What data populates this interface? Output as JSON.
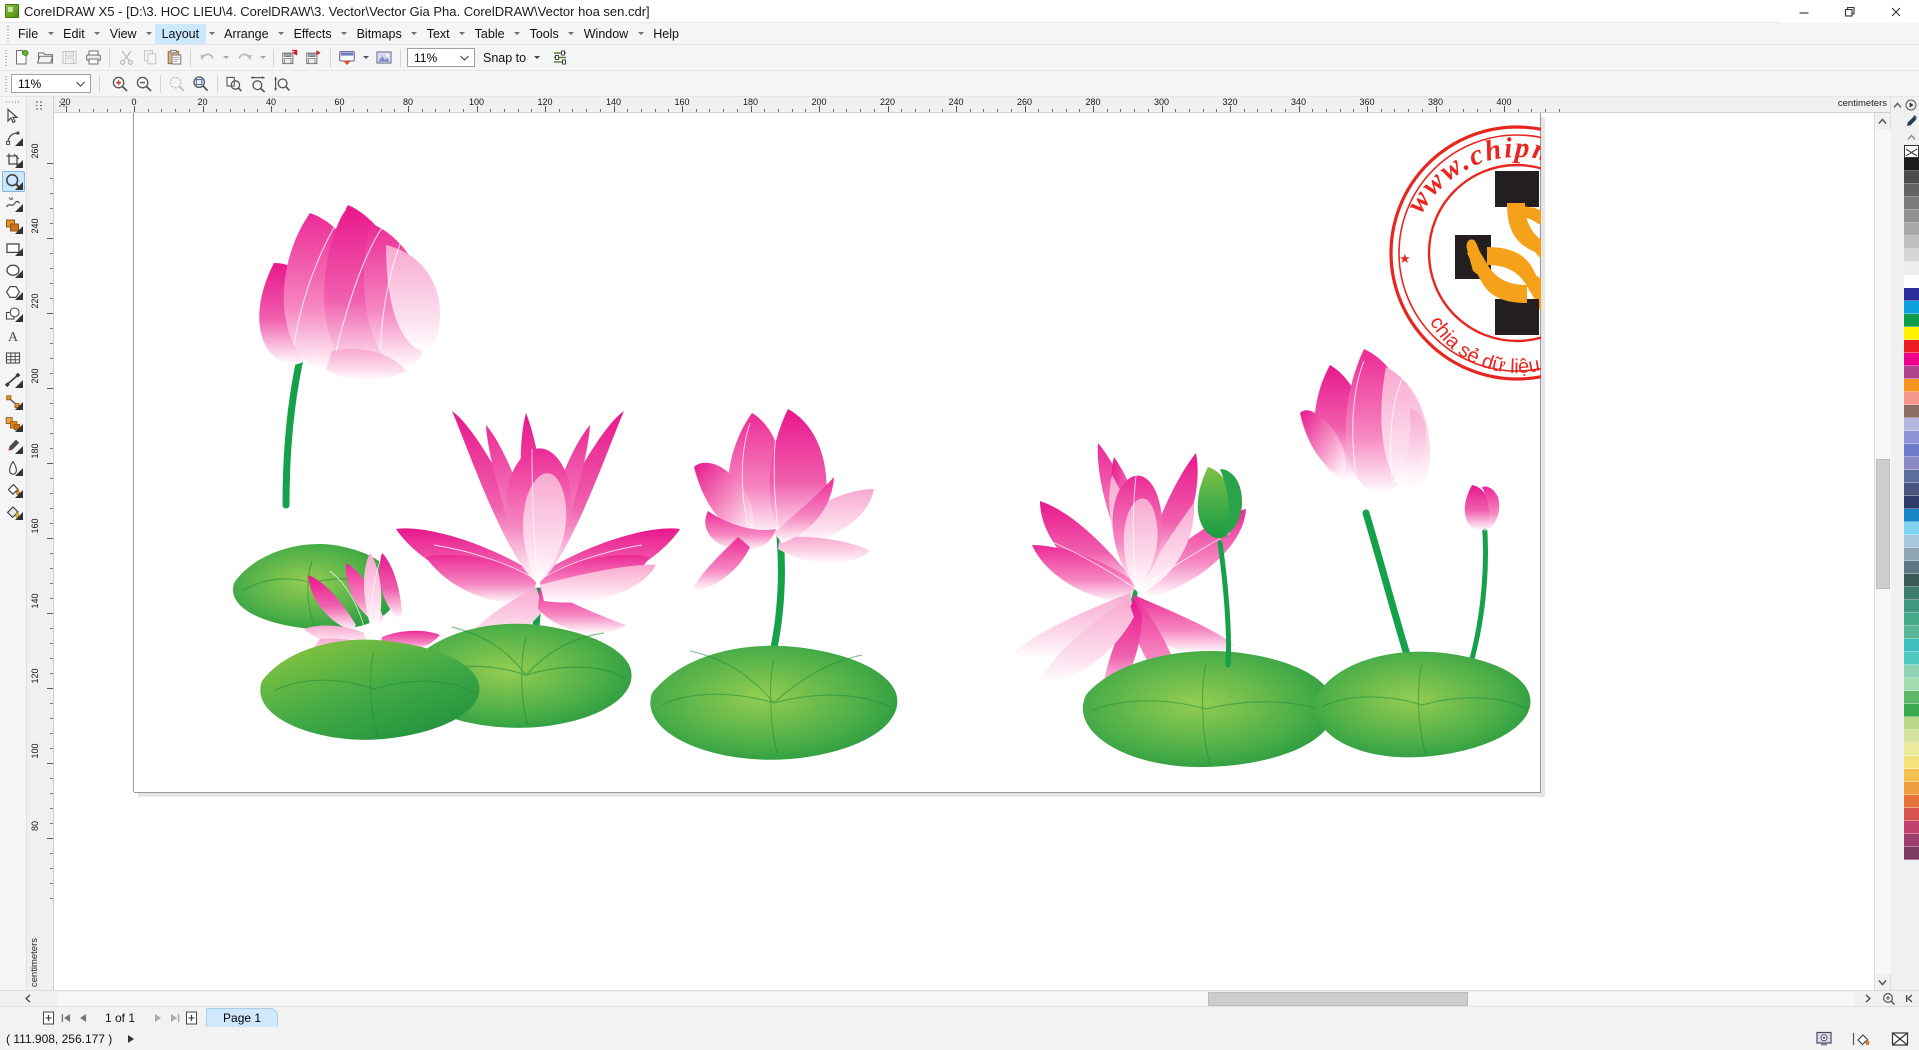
{
  "window": {
    "title": "CoreIDRAW X5 - [D:\\3. HOC LIEU\\4. CorelDRAW\\3. Vector\\Vector Gia Pha. CorelDRAW\\Vector hoa sen.cdr]",
    "app_icon": "coreldraw-icon",
    "minimize_label": "—",
    "restore_label": "❐",
    "close_label": "✕"
  },
  "menubar": {
    "items": [
      {
        "label": "File",
        "active": false
      },
      {
        "label": "Edit",
        "active": false
      },
      {
        "label": "View",
        "active": false
      },
      {
        "label": "Layout",
        "active": true
      },
      {
        "label": "Arrange",
        "active": false
      },
      {
        "label": "Effects",
        "active": false
      },
      {
        "label": "Bitmaps",
        "active": false
      },
      {
        "label": "Text",
        "active": false
      },
      {
        "label": "Table",
        "active": false
      },
      {
        "label": "Tools",
        "active": false
      },
      {
        "label": "Window",
        "active": false
      },
      {
        "label": "Help",
        "active": false
      }
    ]
  },
  "standard_toolbar": {
    "buttons": [
      {
        "name": "new-document-icon",
        "enabled": true
      },
      {
        "name": "open-document-icon",
        "enabled": true
      },
      {
        "name": "save-document-icon",
        "enabled": false
      },
      {
        "name": "print-icon",
        "enabled": true
      },
      {
        "name": "cut-icon",
        "enabled": false
      },
      {
        "name": "copy-icon",
        "enabled": false
      },
      {
        "name": "paste-icon",
        "enabled": true
      },
      {
        "name": "undo-icon",
        "enabled": false
      },
      {
        "name": "redo-icon",
        "enabled": false
      },
      {
        "name": "import-icon",
        "enabled": true
      },
      {
        "name": "export-icon",
        "enabled": true
      },
      {
        "name": "application-launcher-icon",
        "enabled": true
      },
      {
        "name": "corel-connect-icon",
        "enabled": true
      }
    ],
    "zoom_level": {
      "value": "11%",
      "name": "zoom-level-combo"
    },
    "snap_to": {
      "label": "Snap to",
      "name": "snap-to-dropdown"
    },
    "options_icon": "options-icon"
  },
  "property_toolbar": {
    "zoom_level": {
      "value": "11%",
      "name": "zoom-level-property-combo"
    },
    "buttons": [
      {
        "name": "zoom-in-icon"
      },
      {
        "name": "zoom-out-icon"
      },
      {
        "name": "zoom-to-selected-icon",
        "enabled": false
      },
      {
        "name": "zoom-to-all-objects-icon"
      },
      {
        "name": "zoom-to-page-icon"
      },
      {
        "name": "zoom-to-page-width-icon"
      },
      {
        "name": "zoom-to-page-height-icon"
      }
    ]
  },
  "toolbox": {
    "tools": [
      {
        "name": "pick-tool",
        "label": "Pick",
        "active": false,
        "flyout": false
      },
      {
        "name": "shape-tool",
        "label": "Shape",
        "active": false,
        "flyout": true
      },
      {
        "name": "crop-tool",
        "label": "Crop",
        "active": false,
        "flyout": true
      },
      {
        "name": "zoom-tool",
        "label": "Zoom",
        "active": true,
        "flyout": true
      },
      {
        "name": "freehand-tool",
        "label": "Freehand",
        "active": false,
        "flyout": true
      },
      {
        "name": "smart-fill-tool",
        "label": "Smart Fill",
        "active": false,
        "flyout": true
      },
      {
        "name": "rectangle-tool",
        "label": "Rectangle",
        "active": false,
        "flyout": true
      },
      {
        "name": "ellipse-tool",
        "label": "Ellipse",
        "active": false,
        "flyout": true
      },
      {
        "name": "polygon-tool",
        "label": "Polygon",
        "active": false,
        "flyout": true
      },
      {
        "name": "basic-shapes-tool",
        "label": "Basic Shapes",
        "active": false,
        "flyout": true
      },
      {
        "name": "text-tool",
        "label": "Text",
        "active": false,
        "flyout": false
      },
      {
        "name": "table-tool",
        "label": "Table",
        "active": false,
        "flyout": false
      },
      {
        "name": "dimension-tool",
        "label": "Dimension",
        "active": false,
        "flyout": true
      },
      {
        "name": "connector-tool",
        "label": "Connector",
        "active": false,
        "flyout": true
      },
      {
        "name": "blend-tool",
        "label": "Blend",
        "active": false,
        "flyout": true
      },
      {
        "name": "color-eyedropper-tool",
        "label": "Color Eyedropper",
        "active": false,
        "flyout": true
      },
      {
        "name": "outline-tool",
        "label": "Outline",
        "active": false,
        "flyout": true
      },
      {
        "name": "fill-tool",
        "label": "Fill",
        "active": false,
        "flyout": true
      },
      {
        "name": "interactive-fill-tool",
        "label": "Interactive Fill",
        "active": false,
        "flyout": true
      }
    ]
  },
  "rulers": {
    "unit": "centimeters",
    "unit_vertical": "centimeters",
    "horizontal_labels": [
      20,
      0,
      20,
      40,
      60,
      80,
      100,
      120,
      140,
      160,
      180,
      200,
      220,
      240,
      260,
      280,
      300,
      320,
      340,
      360,
      380,
      400
    ],
    "vertical_labels": [
      260,
      240,
      220,
      200,
      180,
      160,
      140,
      120,
      100,
      80
    ]
  },
  "canvas": {
    "artwork_title": "Vector hoa sen",
    "watermark": {
      "name": "chipmia-watermark",
      "top_text": "www.chipmia.net",
      "bottom_text": "chia sẻ dữ liệu miễn phí",
      "ring_color": "#e8261f",
      "hand_color": "#f5a11a",
      "cuff_color": "#231f20",
      "star": "★"
    },
    "palette_colors": {
      "petal_dark": "#e8288e",
      "petal_mid": "#ef5aa8",
      "petal_light": "#fbd3e6",
      "petal_white": "#ffffff",
      "leaf_dark": "#1f9a3e",
      "leaf_mid": "#4eb84b",
      "leaf_light": "#9ed36a",
      "stem": "#17a34a"
    }
  },
  "colorpalette": {
    "name": "default-cmyk-palette",
    "none_swatch": "no-color",
    "swatches": [
      "#1c1c1c",
      "#4c4c4c",
      "#636363",
      "#7a7a7a",
      "#919191",
      "#a8a8a8",
      "#bfbfbf",
      "#d6d6d6",
      "#ededed",
      "#ffffff",
      "#2b2f9e",
      "#0aa2dd",
      "#0d9c4a",
      "#fff200",
      "#ed1c24",
      "#ec008c",
      "#b0458f",
      "#f7941e",
      "#f4978a",
      "#8d6e63",
      "#b4b6e0",
      "#8f94d8",
      "#6f7ccb",
      "#8b8ac4",
      "#5d6d9e",
      "#4a5580",
      "#2e3a6b",
      "#1486c8",
      "#7fd4ef",
      "#a7c8de",
      "#8fa5b3",
      "#5f7782",
      "#3b5a55",
      "#3f7d6e",
      "#3f9a7f",
      "#46a98a",
      "#58b694",
      "#3fbfbf",
      "#4fc9c2",
      "#8fd4b5",
      "#a6dcb2",
      "#5fb86a",
      "#3aa84f",
      "#bcd98a",
      "#d5e3a0",
      "#eceb9a",
      "#f6e27a",
      "#f2c14e",
      "#ef9d3c",
      "#e8743b",
      "#d9534f",
      "#c1406e",
      "#9e3d6b",
      "#7d3a63"
    ]
  },
  "pagebar": {
    "add_page_start_icon": "add-page-before-icon",
    "first_page_icon": "first-page-icon",
    "prev_page_icon": "previous-page-icon",
    "page_counter": "1 of 1",
    "next_page_icon": "next-page-icon",
    "last_page_icon": "last-page-icon",
    "add_page_end_icon": "add-page-after-icon",
    "tabs": [
      {
        "label": "Page 1",
        "active": true,
        "name": "page-tab-1"
      }
    ]
  },
  "statusbar": {
    "coordinates": "( 111.908, 256.177 )",
    "arrow_icon": "expand-arrow-icon",
    "screen_icon": "screen-preview-icon",
    "fill_icon": "fill-color-indicator",
    "outline_icon": "outline-color-indicator"
  },
  "scrollbars": {
    "horizontal_name": "horizontal-scrollbar",
    "vertical_name": "vertical-scrollbar",
    "nav_collapse_icon": "collapse-navigator-icon",
    "navigator_icon": "navigator-icon"
  }
}
